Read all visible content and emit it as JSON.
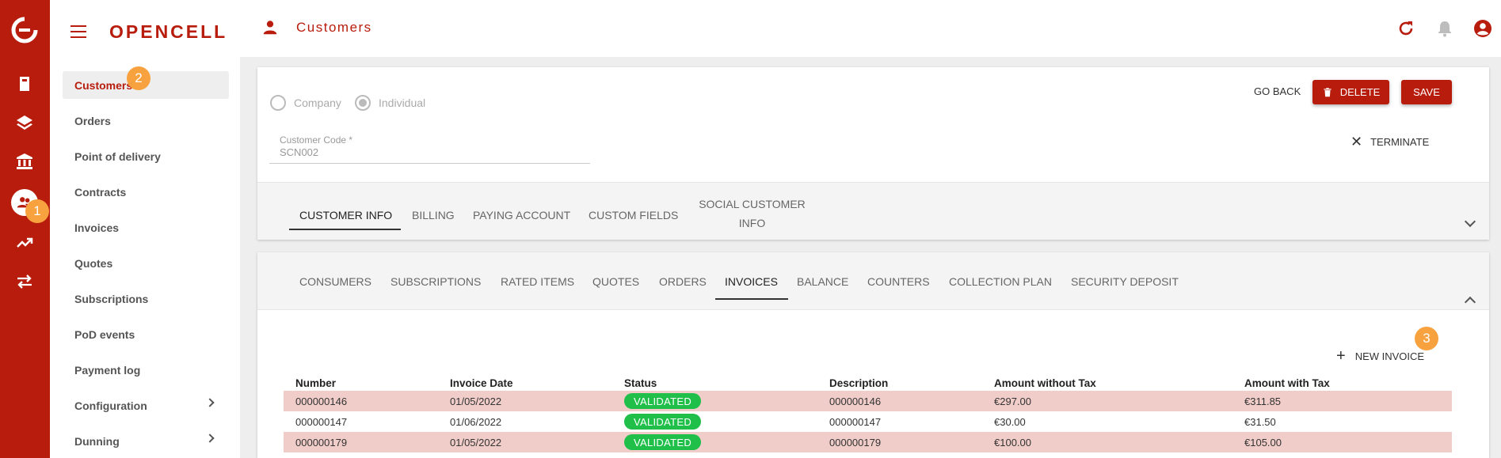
{
  "brand": {
    "name": "OPENCELL"
  },
  "header": {
    "title": "Customers",
    "title_icon": "person-icon"
  },
  "steps": {
    "one": "1",
    "two": "2",
    "three": "3"
  },
  "sidebar": {
    "items": [
      {
        "label": "Customers"
      },
      {
        "label": "Orders"
      },
      {
        "label": "Point of delivery"
      },
      {
        "label": "Contracts"
      },
      {
        "label": "Invoices"
      },
      {
        "label": "Quotes"
      },
      {
        "label": "Subscriptions"
      },
      {
        "label": "PoD events"
      },
      {
        "label": "Payment log"
      },
      {
        "label": "Configuration"
      },
      {
        "label": "Dunning"
      }
    ]
  },
  "form": {
    "type_options": [
      "Company",
      "Individual"
    ],
    "type_selected": "Individual",
    "customer_code_label": "Customer Code *",
    "customer_code_value": "SCN002",
    "go_back": "GO BACK",
    "delete": "DELETE",
    "save": "SAVE",
    "terminate": "TERMINATE"
  },
  "info_tabs": {
    "t0": "CUSTOMER INFO",
    "t1": "BILLING",
    "t2": "PAYING ACCOUNT",
    "t3": "CUSTOM FIELDS",
    "t4a": "SOCIAL CUSTOMER",
    "t4b": "INFO",
    "active": "CUSTOMER INFO"
  },
  "detail_tabs": {
    "items": [
      "CONSUMERS",
      "SUBSCRIPTIONS",
      "RATED ITEMS",
      "QUOTES",
      "ORDERS",
      "INVOICES",
      "BALANCE",
      "COUNTERS",
      "COLLECTION PLAN",
      "SECURITY DEPOSIT"
    ],
    "active": "INVOICES"
  },
  "invoices": {
    "new_label": "NEW INVOICE",
    "headers": [
      "Number",
      "Invoice Date",
      "Status",
      "Description",
      "Amount without Tax",
      "Amount with Tax"
    ],
    "rows": [
      [
        "000000146",
        "01/05/2022",
        "VALIDATED",
        "000000146",
        "€297.00",
        "€311.85"
      ],
      [
        "000000147",
        "01/06/2022",
        "VALIDATED",
        "000000147",
        "€30.00",
        "€31.50"
      ],
      [
        "000000179",
        "01/05/2022",
        "VALIDATED",
        "000000179",
        "€100.00",
        "€105.00"
      ]
    ]
  },
  "colors": {
    "brand": "#b81c0c",
    "status_validated": "#1fbf4a",
    "row_highlight": "#f0cdc9",
    "step_badge": "#f7a23e"
  }
}
